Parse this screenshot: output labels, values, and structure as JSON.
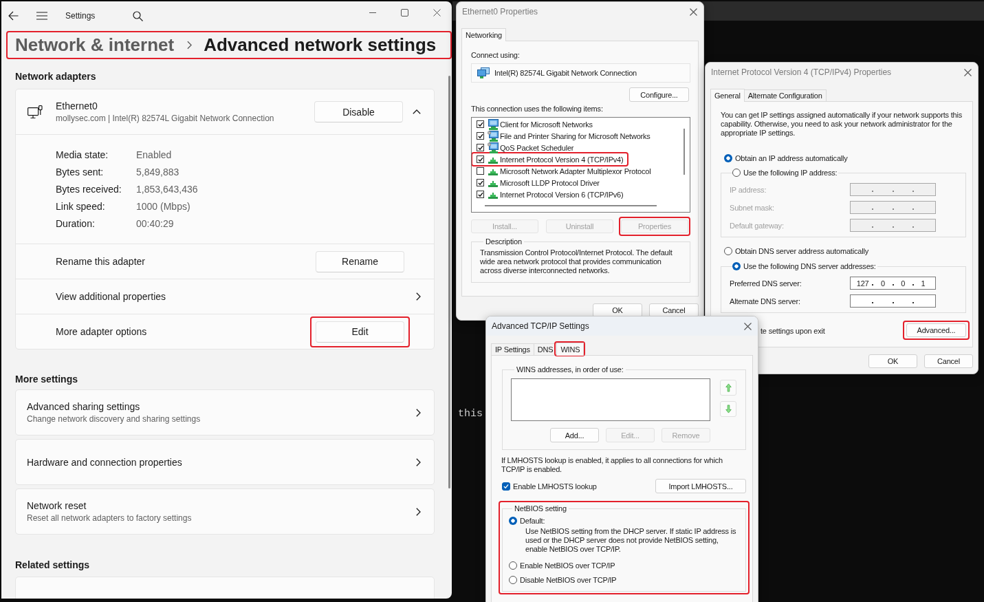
{
  "terminal": {
    "text": "this"
  },
  "settings_window": {
    "title": "Settings",
    "breadcrumb": {
      "parent": "Network & internet",
      "current": "Advanced network settings",
      "highlighted": true
    },
    "network_adapters": {
      "heading": "Network adapters",
      "adapter": {
        "name": "Ethernet0",
        "description": "mollysec.com | Intel(R) 82574L Gigabit Network Connection",
        "toggle_button": "Disable",
        "expanded": true,
        "details": [
          {
            "label": "Media state:",
            "value": "Enabled"
          },
          {
            "label": "Bytes sent:",
            "value": "5,849,883"
          },
          {
            "label": "Bytes received:",
            "value": "1,853,643,436"
          },
          {
            "label": "Link speed:",
            "value": "1000 (Mbps)"
          },
          {
            "label": "Duration:",
            "value": "00:40:29"
          }
        ],
        "actions": [
          {
            "kind": "button",
            "label": "Rename this adapter",
            "button": "Rename",
            "highlighted": false
          },
          {
            "kind": "link",
            "label": "View additional properties",
            "highlighted": false
          },
          {
            "kind": "button",
            "label": "More adapter options",
            "button": "Edit",
            "highlighted": true
          }
        ]
      }
    },
    "more_settings": {
      "heading": "More settings",
      "items": [
        {
          "title": "Advanced sharing settings",
          "subtitle": "Change network discovery and sharing settings"
        },
        {
          "title": "Hardware and connection properties"
        },
        {
          "title": "Network reset",
          "subtitle": "Reset all network adapters to factory settings"
        }
      ]
    },
    "related_settings": {
      "heading": "Related settings"
    }
  },
  "ethernet_properties": {
    "title": "Ethernet0 Properties",
    "active": false,
    "tabs": [
      {
        "label": "Networking",
        "selected": true
      }
    ],
    "connect_label": "Connect using:",
    "adapter": "Intel(R) 82574L Gigabit Network Connection",
    "configure_button": "Configure...",
    "items_label": "This connection uses the following items:",
    "items": [
      {
        "kind": "client",
        "label": "Client for Microsoft Networks",
        "checked": true,
        "highlighted": false
      },
      {
        "kind": "service",
        "label": "File and Printer Sharing for Microsoft Networks",
        "checked": true,
        "highlighted": false
      },
      {
        "kind": "service",
        "label": "QoS Packet Scheduler",
        "checked": true,
        "highlighted": false
      },
      {
        "kind": "protocol",
        "label": "Internet Protocol Version 4 (TCP/IPv4)",
        "checked": true,
        "highlighted": true
      },
      {
        "kind": "protocol",
        "label": "Microsoft Network Adapter Multiplexor Protocol",
        "checked": false,
        "highlighted": false
      },
      {
        "kind": "protocol",
        "label": "Microsoft LLDP Protocol Driver",
        "checked": true,
        "highlighted": false
      },
      {
        "kind": "protocol",
        "label": "Internet Protocol Version 6 (TCP/IPv6)",
        "checked": true,
        "highlighted": false
      }
    ],
    "item_buttons": [
      {
        "label": "Install...",
        "disabled": true,
        "highlighted": false
      },
      {
        "label": "Uninstall",
        "disabled": true,
        "highlighted": false
      },
      {
        "label": "Properties",
        "disabled": true,
        "highlighted": true
      }
    ],
    "description": {
      "heading": "Description",
      "text": "Transmission Control Protocol/Internet Protocol. The default wide area network protocol that provides communication across diverse interconnected networks."
    },
    "dialog_buttons": [
      "OK",
      "Cancel"
    ]
  },
  "ipv4_properties": {
    "title": "Internet Protocol Version 4 (TCP/IPv4) Properties",
    "active": false,
    "tabs": [
      {
        "label": "General",
        "selected": true
      },
      {
        "label": "Alternate Configuration",
        "selected": false
      }
    ],
    "intro": "You can get IP settings assigned automatically if your network supports this capability. Otherwise, you need to ask your network administrator for the appropriate IP settings.",
    "ip_options": [
      {
        "label": "Obtain an IP address automatically",
        "selected": true
      },
      {
        "label": "Use the following IP address:",
        "selected": false
      }
    ],
    "ip_fields": [
      {
        "label": "IP address:",
        "disabled": true
      },
      {
        "label": "Subnet mask:",
        "disabled": true
      },
      {
        "label": "Default gateway:",
        "disabled": true
      }
    ],
    "dns_options": [
      {
        "label": "Obtain DNS server address automatically",
        "selected": false
      },
      {
        "label": "Use the following DNS server addresses:",
        "selected": true
      }
    ],
    "dns_fields": [
      {
        "label": "Preferred DNS server:",
        "disabled": false,
        "octets": [
          "127",
          "0",
          "0",
          "1"
        ]
      },
      {
        "label": "Alternate DNS server:",
        "disabled": false
      }
    ],
    "validate_label": "te settings upon exit",
    "advanced_button": {
      "label": "Advanced...",
      "highlighted": true
    },
    "dialog_buttons": [
      "OK",
      "Cancel"
    ]
  },
  "advanced_tcpip": {
    "title": "Advanced TCP/IP Settings",
    "active": true,
    "tabs": [
      {
        "label": "IP Settings",
        "selected": false,
        "highlighted": false
      },
      {
        "label": "DNS",
        "selected": false,
        "highlighted": false
      },
      {
        "label": "WINS",
        "selected": true,
        "highlighted": true
      }
    ],
    "wins_label": "WINS addresses, in order of use:",
    "list_buttons": [
      {
        "label": "Add...",
        "disabled": false
      },
      {
        "label": "Edit...",
        "disabled": true
      },
      {
        "label": "Remove",
        "disabled": true
      }
    ],
    "lmhosts_note": "If LMHOSTS lookup is enabled, it applies to all connections for which TCP/IP is enabled.",
    "lmhosts_checkbox": {
      "label": "Enable LMHOSTS lookup",
      "checked": true
    },
    "import_button": "Import LMHOSTS...",
    "netbios": {
      "label": "NetBIOS setting",
      "highlighted": true,
      "options": [
        {
          "label": "Default:",
          "selected": true,
          "description": "Use NetBIOS setting from the DHCP server. If static IP address is used or the DHCP server does not provide NetBIOS setting, enable NetBIOS over TCP/IP."
        },
        {
          "label": "Enable NetBIOS over TCP/IP",
          "selected": false
        },
        {
          "label": "Disable NetBIOS over TCP/IP",
          "selected": false
        }
      ]
    }
  }
}
